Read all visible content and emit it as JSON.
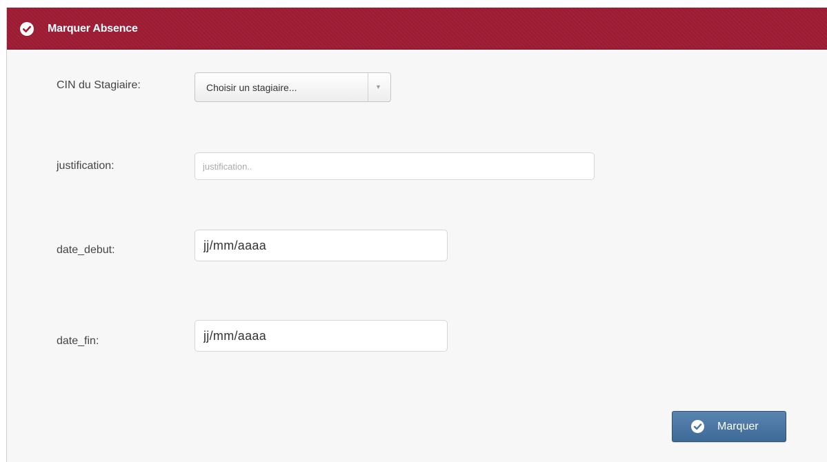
{
  "header": {
    "title": "Marquer Absence",
    "icon": "check-circle-icon",
    "color": "#9c1c34"
  },
  "form": {
    "cin": {
      "label": "CIN du Stagiaire:",
      "selected_value": "Choisir un stagiaire...",
      "arrow": "▼"
    },
    "justification": {
      "label": "justification:",
      "placeholder": "justification.."
    },
    "date_debut": {
      "label": "date_debut:",
      "placeholder": "jj/mm/aaaa"
    },
    "date_fin": {
      "label": "date_fin:",
      "placeholder": "jj/mm/aaaa"
    }
  },
  "submit": {
    "label": "Marquer",
    "icon": "check-circle-icon",
    "color": "#4a76a5"
  }
}
